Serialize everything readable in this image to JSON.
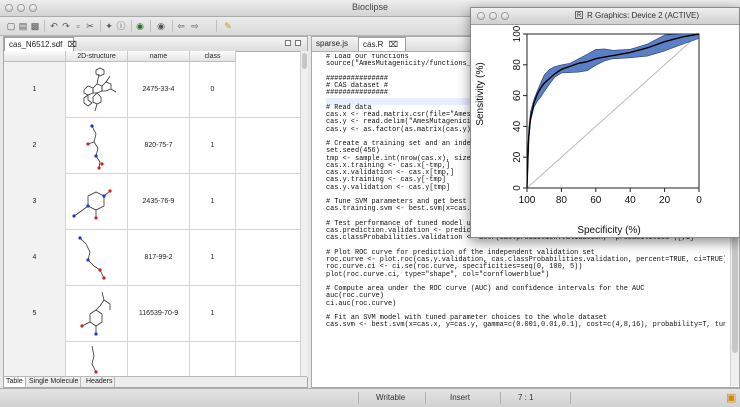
{
  "app": {
    "title": "Bioclipse"
  },
  "left_editor": {
    "tab_label": "cas_N6512.sdf",
    "columns": [
      "",
      "2D-structure",
      "name",
      "class"
    ],
    "rows": [
      {
        "index": "1",
        "name": "2475-33-4",
        "class": "0"
      },
      {
        "index": "2",
        "name": "820-75-7",
        "class": "1"
      },
      {
        "index": "3",
        "name": "2435-76-9",
        "class": "1"
      },
      {
        "index": "4",
        "name": "817-99-2",
        "class": "1"
      },
      {
        "index": "5",
        "name": "116539-70-9",
        "class": "1"
      }
    ],
    "bottom_tabs": [
      "Table",
      "Single Molecule",
      "Headers"
    ]
  },
  "right_editor": {
    "tabs": [
      "sparse.js",
      "cas.R"
    ],
    "code_lines": [
      "# Load our functions",
      "source(\"AmesMutagenicity/functions_c",
      "",
      "###############",
      "# CAS dataset #",
      "###############",
      "",
      "# Read data",
      "cas.x <- read.matrix.csr(file=\"AmesM",
      "cas.y <- read.delim(\"AmesMutagenicit",
      "cas.y <- as.factor(as.matrix(cas.y))",
      "",
      "# Create a training set and an indep",
      "set.seed(456)",
      "tmp <- sample.int(nrow(cas.x), size=",
      "cas.x.training <- cas.x[-tmp,]",
      "cas.x.validation <- cas.x[tmp,]",
      "cas.y.training <- cas.y[-tmp]",
      "cas.y.validation <- cas.y[tmp]",
      "",
      "# Tune SVM parameters and get best m",
      "cas.training.svm <- best.svm(x=cas.x",
      "",
      "# Test performance of tuned model using the independent validation set",
      "cas.prediction.validation <- predict(cas.training.svm, cas.x.validation, probability=T)",
      "cas.classProbabilities.validation <- attr(cas.prediction.validation, \"probabilities\")[,1]",
      "",
      "# Plot ROC curve for prediction of the independent validation set",
      "roc.curve <- plot.roc(cas.y.validation, cas.classProbabilities.validation, percent=TRUE, ci=TRUE)",
      "roc.curve.ci <- ci.se(roc.curve, specificities=seq(0, 100, 5))",
      "plot(roc.curve.ci, type=\"shape\", col=\"cornflowerblue\")",
      "",
      "# Compute area under the ROC curve (AUC) and confidence intervals for the AUC",
      "auc(roc.curve)",
      "ci.auc(roc.curve)",
      "",
      "# Fit an SVM model with tuned parameter choices to the whole dataset",
      "cas.svm <- best.svm(x=cas.x, y=cas.y, gamma=c(0.001,0.01,0.1), cost=c(4,8,16), probability=T, tunec"
    ]
  },
  "status_bar": {
    "writable": "Writable",
    "insert_mode": "Insert",
    "position": "7 : 1"
  },
  "r_window": {
    "title": "R Graphics: Device 2 (ACTIVE)",
    "xlabel": "Specificity (%)",
    "ylabel": "Sensitivity (%)",
    "x_ticks": [
      "100",
      "80",
      "60",
      "40",
      "20",
      "0"
    ],
    "y_ticks": [
      "0",
      "20",
      "40",
      "60",
      "80",
      "100"
    ]
  },
  "chart_data": {
    "type": "line",
    "xlabel": "Specificity (%)",
    "ylabel": "Sensitivity (%)",
    "xlim": [
      100,
      0
    ],
    "ylim": [
      0,
      100
    ],
    "series": [
      {
        "x": [
          100,
          99.5,
          99,
          98,
          96,
          94,
          92,
          90,
          87,
          84,
          80,
          75,
          70,
          65,
          60,
          55,
          50,
          40,
          30,
          20,
          10,
          0
        ],
        "values": [
          0,
          18,
          33,
          45,
          55,
          61,
          65,
          68,
          71,
          74,
          77,
          79,
          81,
          82,
          84,
          85,
          86,
          88,
          91,
          95,
          98,
          100
        ]
      }
    ],
    "ci_band_color": "#5a7fc4",
    "reference_line": true
  }
}
